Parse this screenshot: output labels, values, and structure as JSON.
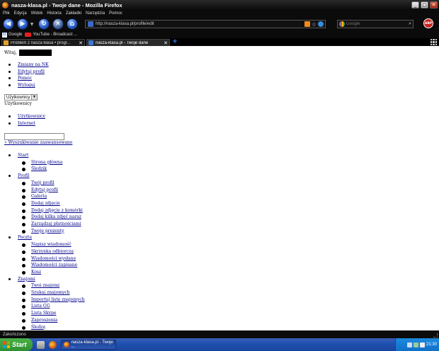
{
  "window": {
    "title": "nasza-klasa.pl - Twoje dane - Mozilla Firefox",
    "minimize": "_",
    "maximize": "□",
    "close": "✕"
  },
  "menu": [
    "Plik",
    "Edycja",
    "Widok",
    "Historia",
    "Zakładki",
    "Narzędzia",
    "Pomoc"
  ],
  "nav": {
    "url": "http://nasza-klasa.pl/profile/edit",
    "search_placeholder": "Google",
    "abp_label": "ABP"
  },
  "bookmarks": [
    {
      "label": "Google"
    },
    {
      "label": "YouTube - Broadcast ..."
    }
  ],
  "tabs": [
    {
      "label": "Problem z nasza klasa • progr...",
      "active": false
    },
    {
      "label": "nasza-klasa.pl - Twoje dane",
      "active": true
    }
  ],
  "page": {
    "greeting": "Witaj,",
    "top_links": [
      "Zmiany na NK",
      "Edytuj profil",
      "Pomoc",
      "Wyloguj"
    ],
    "select_value": "Użytkownicy",
    "select_caption": "Użytkownicy",
    "mid_links": [
      "Użytkownicy",
      "Internet"
    ],
    "advanced_search": "» Wyszukiwanie zaawansowane",
    "sections": [
      {
        "label": "Start",
        "items": [
          "Strona główna",
          "Śledzik"
        ]
      },
      {
        "label": "Profil",
        "items": [
          "Twój profil",
          "Edytuj profil",
          "Galeria",
          "Dodaj zdjęcie",
          "Dodaj zdjęcie z komórki",
          "Dodaj kilka zdjęć naraz",
          "Zarządzaj płatnościami",
          "Twoje prezenty"
        ]
      },
      {
        "label": "Poczta",
        "items": [
          "Napisz wiadomość",
          "Skrzynka odbiorcza",
          "Wiadomości wysłane",
          "Wiadomości zapisane",
          "Kosz"
        ]
      },
      {
        "label": "Znajomi",
        "items": [
          "Twoi znajomi",
          "Szukaj znajomych",
          "Importuj listę znajomych",
          "Lista GG",
          "Lista Skype",
          "Zaproszenia",
          "Śledzę"
        ]
      }
    ]
  },
  "status": "Zakończono",
  "taskbar": {
    "start": "Start",
    "item": "nasza-klasa.pl - Twoje ...",
    "clock": "21:30"
  }
}
